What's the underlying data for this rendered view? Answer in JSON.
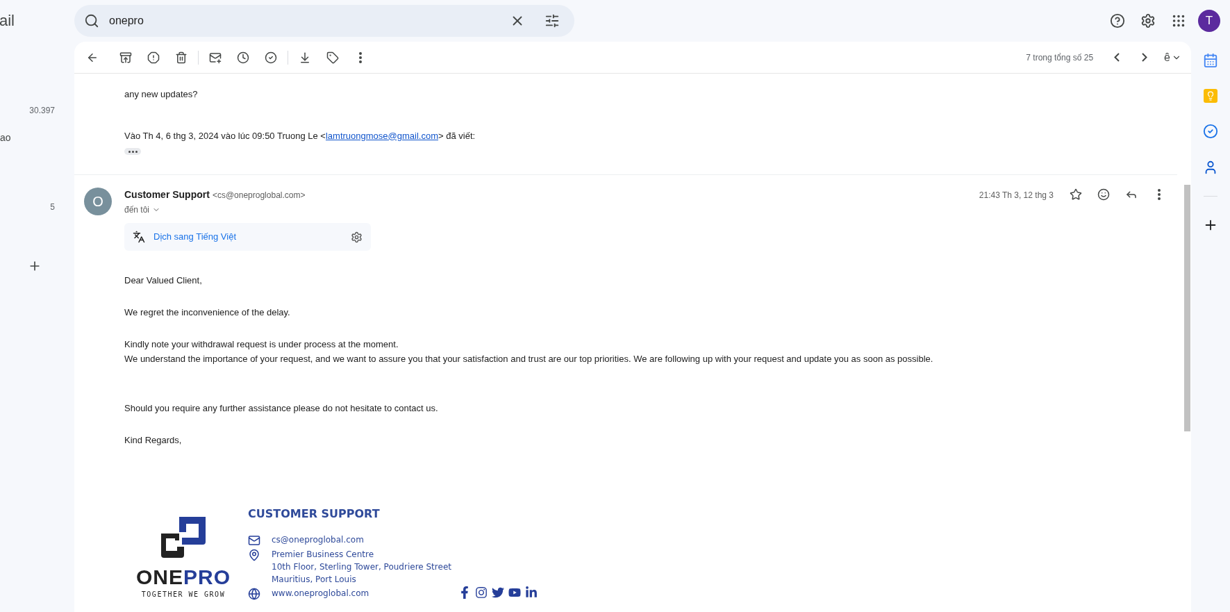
{
  "app_title_fragment": "ail",
  "search": {
    "value": "onepro"
  },
  "sidebar": {
    "items": [
      {
        "label": "30.397",
        "kind": "count"
      },
      {
        "label": "ao",
        "kind": "label"
      },
      {
        "label": "5",
        "kind": "count"
      }
    ]
  },
  "toolbar": {
    "pagination": "7 trong tổng số 25",
    "input_tool": "ê"
  },
  "account": {
    "initial": "T"
  },
  "quoted_message": {
    "body": "any new updates?",
    "attribution_before": "Vào Th 4, 6 thg 3, 2024 vào lúc 09:50 Truong Le <",
    "attribution_link": "lamtruongmose@gmail.com",
    "attribution_after": "> đã viết:"
  },
  "message": {
    "avatar_initial": "O",
    "sender_name": "Customer Support",
    "sender_email": "<cs@oneproglobal.com>",
    "recipient": "đến tôi",
    "time": "21:43 Th 3, 12 thg 3",
    "translate_label": "Dịch sang Tiếng Việt",
    "paragraphs": [
      [
        "Dear Valued Client,"
      ],
      [
        "We regret the inconvenience of the delay."
      ],
      [
        "Kindly note your withdrawal request is under process at the moment.",
        "We understand the importance of your request, and we want to assure you that your satisfaction and trust are our top priorities. We are following up with your request and update you as soon as possible."
      ],
      [
        "Should you require any further assistance please do not hesitate to contact us."
      ],
      [
        "Kind Regards,"
      ]
    ]
  },
  "signature": {
    "logo_dark": "ONE",
    "logo_accent": "PRO",
    "tagline": "TOGETHER WE GROW",
    "heading": "CUSTOMER SUPPORT",
    "contacts": [
      {
        "kind": "email",
        "lines": [
          "cs@oneproglobal.com"
        ]
      },
      {
        "kind": "location",
        "lines": [
          "Premier Business Centre",
          "10th Floor, Sterling Tower, Poudriere Street",
          "Mauritius, Port Louis"
        ]
      },
      {
        "kind": "web",
        "lines": [
          "www.oneproglobal.com"
        ]
      }
    ]
  }
}
